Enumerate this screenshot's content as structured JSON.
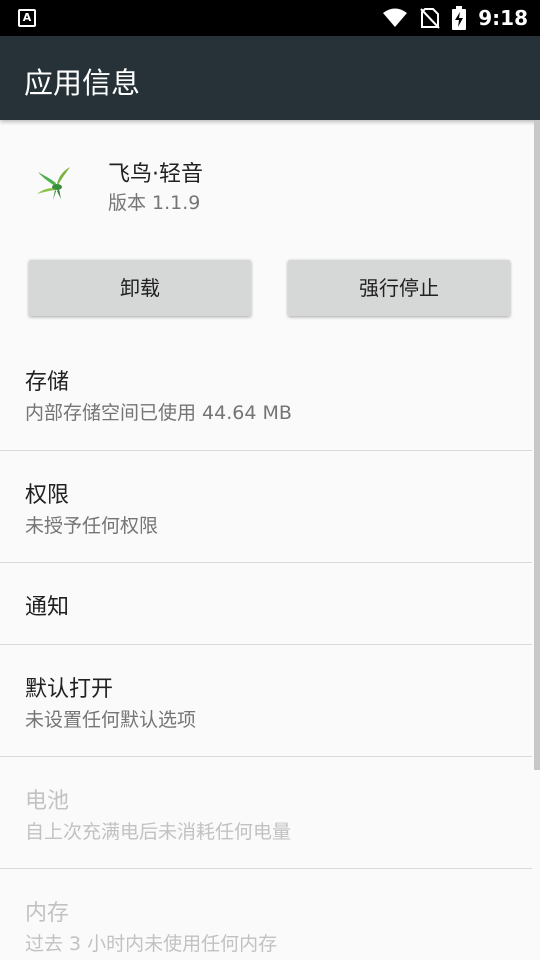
{
  "status_bar": {
    "time": "9:18",
    "left_icon_letter": "A",
    "icons": [
      "wifi-icon",
      "no-sim-icon",
      "battery-charging-icon"
    ]
  },
  "app_bar": {
    "title": "应用信息"
  },
  "app": {
    "name": "飞鸟·轻音",
    "version": "版本 1.1.9"
  },
  "buttons": {
    "uninstall": "卸载",
    "force_stop": "强行停止"
  },
  "settings": {
    "storage": {
      "title": "存储",
      "summary": "内部存储空间已使用 44.64 MB"
    },
    "permissions": {
      "title": "权限",
      "summary": "未授予任何权限"
    },
    "notifications": {
      "title": "通知"
    },
    "open_by_default": {
      "title": "默认打开",
      "summary": "未设置任何默认选项"
    },
    "battery": {
      "title": "电池",
      "summary": "自上次充满电后未消耗任何电量"
    },
    "memory": {
      "title": "内存",
      "summary": "过去 3 小时内未使用任何内存"
    }
  },
  "colors": {
    "app_bar": "#263238",
    "status_bar": "#000000",
    "background": "#fafafa",
    "button": "#d6d7d7",
    "disabled_text": "#c2c2c2"
  }
}
